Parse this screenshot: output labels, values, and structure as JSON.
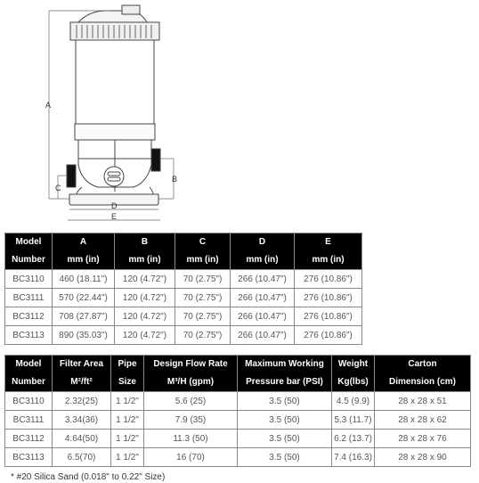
{
  "drawing": {
    "labels": {
      "A": "A",
      "B": "B",
      "C": "C",
      "D": "D",
      "E": "E"
    }
  },
  "dimensions_table": {
    "headers": [
      {
        "line1": "Model",
        "line2": "Number"
      },
      {
        "line1": "A",
        "line2": "mm (in)"
      },
      {
        "line1": "B",
        "line2": "mm (in)"
      },
      {
        "line1": "C",
        "line2": "mm (in)"
      },
      {
        "line1": "D",
        "line2": "mm (in)"
      },
      {
        "line1": "E",
        "line2": "mm (in)"
      }
    ],
    "rows": [
      [
        "BC3110",
        "460 (18.11\")",
        "120 (4.72\")",
        "70 (2.75\")",
        "266 (10.47\")",
        "276 (10.86\")"
      ],
      [
        "BC3111",
        "570 (22.44\")",
        "120 (4.72\")",
        "70 (2.75\")",
        "266 (10.47\")",
        "276 (10.86\")"
      ],
      [
        "BC3112",
        "708 (27.87\")",
        "120 (4.72\")",
        "70 (2.75\")",
        "266 (10.47\")",
        "276 (10.86\")"
      ],
      [
        "BC3113",
        "890 (35.03\")",
        "120 (4.72\")",
        "70 (2.75\")",
        "266 (10.47\")",
        "276 (10.86\")"
      ]
    ]
  },
  "specs_table": {
    "headers": [
      {
        "line1": "Model",
        "line2": "Number"
      },
      {
        "line1": "Filter Area",
        "line2": "M²/ft²"
      },
      {
        "line1": "Pipe",
        "line2": "Size"
      },
      {
        "line1": "Design Flow Rate",
        "line2": "M³/H (gpm)"
      },
      {
        "line1": "Maximum Working",
        "line2": "Pressure bar (PSI)"
      },
      {
        "line1": "Weight",
        "line2": "Kg(lbs)"
      },
      {
        "line1": "Carton",
        "line2": "Dimension (cm)"
      }
    ],
    "rows": [
      [
        "BC3110",
        "2.32(25)",
        "1 1/2\"",
        "5.6 (25)",
        "3.5 (50)",
        "4.5 (9.9)",
        "28 x 28 x 51"
      ],
      [
        "BC3111",
        "3.34(36)",
        "1 1/2\"",
        "7.9 (35)",
        "3.5 (50)",
        "5.3 (11.7)",
        "28 x 28 x 62"
      ],
      [
        "BC3112",
        "4.64(50)",
        "1 1/2\"",
        "11.3 (50)",
        "3.5 (50)",
        "6.2 (13.7)",
        "28 x 28 x 76"
      ],
      [
        "BC3113",
        "6.5(70)",
        "1 1/2\"",
        "16 (70)",
        "3.5 (50)",
        "7.4 (16.3)",
        "28 x 28 x 90"
      ]
    ]
  },
  "footnote": "* #20 Silica Sand (0.018\" to 0.22\" Size)"
}
